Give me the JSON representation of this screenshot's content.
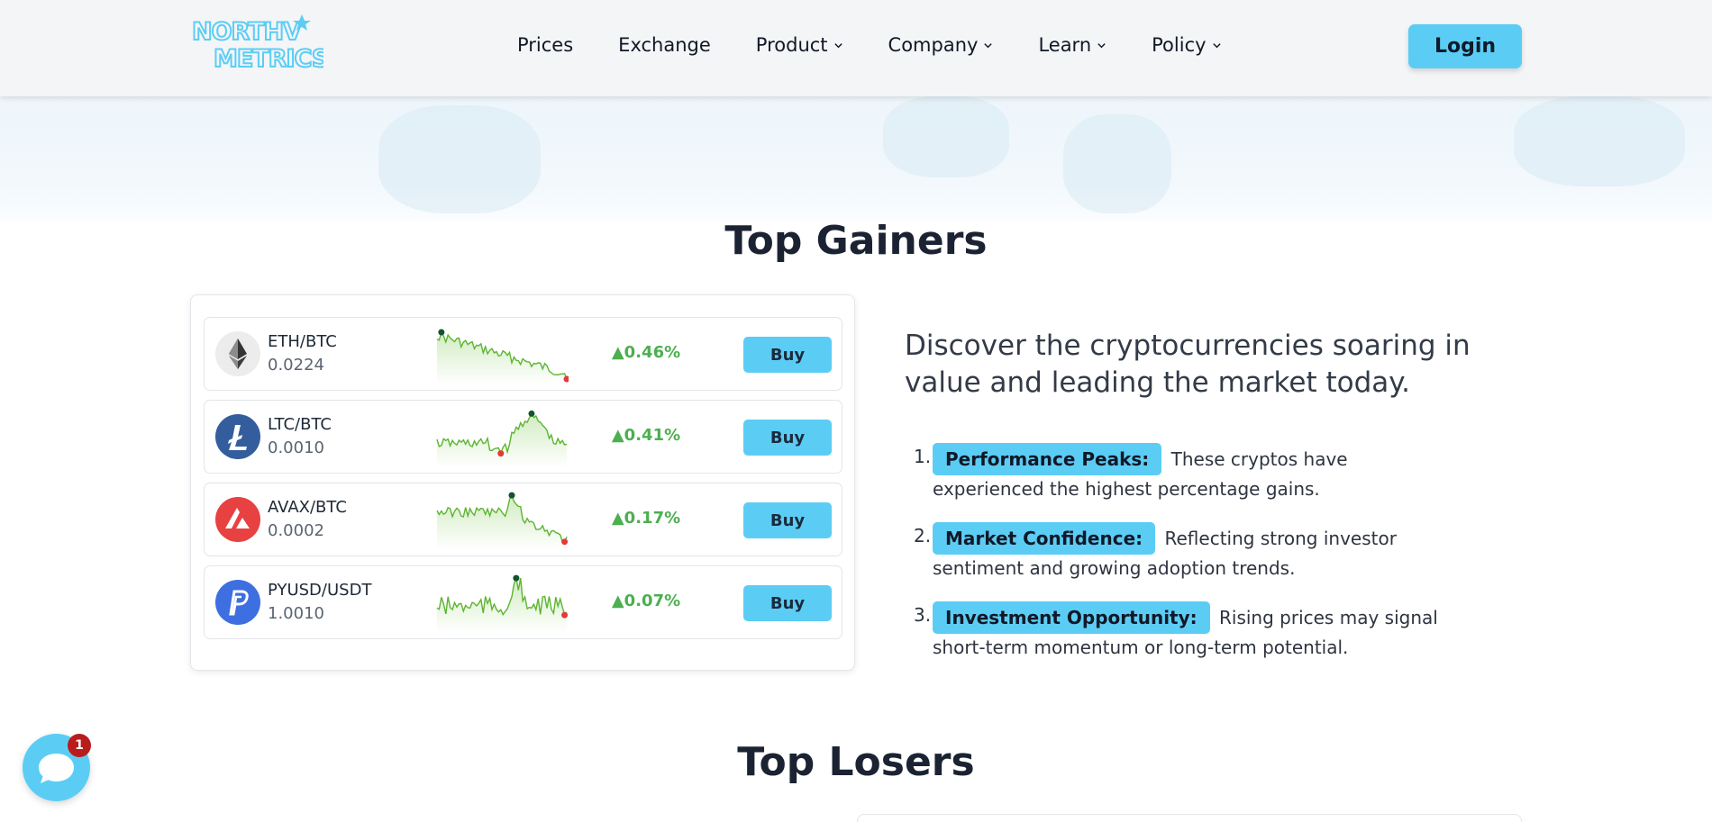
{
  "header": {
    "logo_text_1": "NORTHV",
    "logo_text_2": "METRICS",
    "nav": [
      {
        "label": "Prices",
        "dropdown": false
      },
      {
        "label": "Exchange",
        "dropdown": false
      },
      {
        "label": "Product",
        "dropdown": true
      },
      {
        "label": "Company",
        "dropdown": true
      },
      {
        "label": "Learn",
        "dropdown": true
      },
      {
        "label": "Policy",
        "dropdown": true
      }
    ],
    "login_label": "Login"
  },
  "gainers": {
    "title": "Top Gainers",
    "rows": [
      {
        "pair": "ETH/BTC",
        "price": "0.0224",
        "change": "▲0.46%",
        "buy_label": "Buy",
        "icon": "ethereum-icon",
        "icon_color": "#ececec"
      },
      {
        "pair": "LTC/BTC",
        "price": "0.0010",
        "change": "▲0.41%",
        "buy_label": "Buy",
        "icon": "litecoin-icon",
        "icon_color": "#345d9d"
      },
      {
        "pair": "AVAX/BTC",
        "price": "0.0002",
        "change": "▲0.17%",
        "buy_label": "Buy",
        "icon": "avalanche-icon",
        "icon_color": "#e84142"
      },
      {
        "pair": "PYUSD/USDT",
        "price": "1.0010",
        "change": "▲0.07%",
        "buy_label": "Buy",
        "icon": "paypal-usd-icon",
        "icon_color": "#3d6fe0"
      }
    ],
    "intro": "Discover the cryptocurrencies soaring in value and leading the market today.",
    "features": [
      {
        "num": "1.",
        "tag": "Performance Peaks:",
        "text": "These cryptos have experienced the highest percentage gains."
      },
      {
        "num": "2.",
        "tag": "Market Confidence:",
        "text": "Reflecting strong investor sentiment and growing adoption trends."
      },
      {
        "num": "3.",
        "tag": "Investment Opportunity:",
        "text": "Rising prices may signal short-term momentum or long-term potential."
      }
    ]
  },
  "losers": {
    "title": "Top Losers"
  },
  "chat": {
    "badge_count": "1"
  },
  "colors": {
    "accent": "#5bcdf5",
    "positive": "#4caf50",
    "spark_line": "#5cb531",
    "high_dot": "#14532d",
    "low_dot": "#e53935"
  }
}
